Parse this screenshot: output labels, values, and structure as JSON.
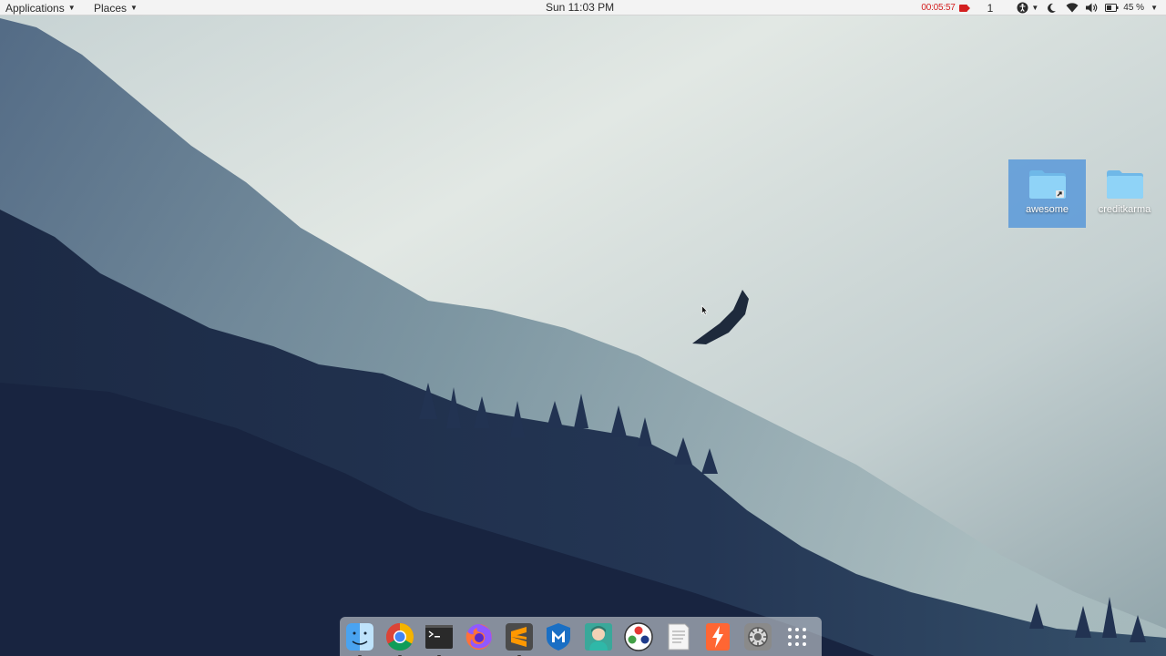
{
  "topbar": {
    "applications_label": "Applications",
    "places_label": "Places",
    "clock": "Sun 11:03 PM",
    "timer": "00:05:57",
    "workspace_number": "1",
    "battery_percent": "45 %"
  },
  "desktop": {
    "icons": [
      {
        "label": "awesome",
        "selected": true
      },
      {
        "label": "creditkarma",
        "selected": false
      }
    ]
  },
  "dock": {
    "items": [
      {
        "name": "finder-icon",
        "running": true
      },
      {
        "name": "chrome-icon",
        "running": true
      },
      {
        "name": "terminal-icon",
        "running": true
      },
      {
        "name": "firefox-icon",
        "running": false
      },
      {
        "name": "sublime-text-icon",
        "running": true
      },
      {
        "name": "metasploit-icon",
        "running": false
      },
      {
        "name": "avatar-app-icon",
        "running": false
      },
      {
        "name": "color-balls-icon",
        "running": false
      },
      {
        "name": "text-editor-icon",
        "running": false
      },
      {
        "name": "burp-suite-icon",
        "running": false
      },
      {
        "name": "system-settings-icon",
        "running": false
      },
      {
        "name": "app-grid-icon",
        "running": false
      }
    ]
  },
  "colors": {
    "selection": "#4a90d9",
    "timer_red": "#d32020",
    "folder_blue": "#7ec8f2"
  }
}
